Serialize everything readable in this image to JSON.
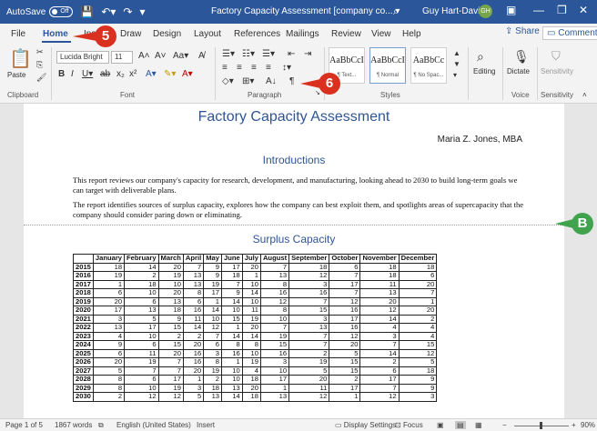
{
  "titlebar": {
    "autosave_label": "AutoSave",
    "autosave_state": "Off",
    "title": "Factory Capacity Assessment [company co...",
    "title_dropdown": "▾",
    "user_name": "Guy Hart-Davis",
    "user_initials": "GH",
    "accent_color": "#2b579a"
  },
  "tabs": {
    "items": [
      "File",
      "Home",
      "Insert",
      "Draw",
      "Design",
      "Layout",
      "References",
      "Mailings",
      "Review",
      "View",
      "Help"
    ],
    "active": "Home",
    "share_label": "Share",
    "comments_label": "Comments"
  },
  "ribbon": {
    "clipboard": {
      "paste_label": "Paste",
      "group_label": "Clipboard"
    },
    "font": {
      "font_name": "Lucida Bright",
      "font_size": "11",
      "group_label": "Font"
    },
    "paragraph": {
      "group_label": "Paragraph"
    },
    "styles": {
      "group_label": "Styles",
      "items": [
        {
          "sample": "AaBbCcI",
          "name": "¶ Text..."
        },
        {
          "sample": "AaBbCcI",
          "name": "¶ Normal"
        },
        {
          "sample": "AaBbCc",
          "name": "¶ No Spac..."
        }
      ]
    },
    "editing_label": "Editing",
    "dictate_label": "Dictate",
    "voice_label": "Voice",
    "sensitivity_label": "Sensitivity",
    "sensitivity_group_label": "Sensitivity"
  },
  "callouts": {
    "step5": "5",
    "step6": "6",
    "stepB": "B"
  },
  "document": {
    "title": "Factory Capacity Assessment",
    "author": "Maria Z. Jones, MBA",
    "h_intro": "Introductions",
    "para1": "This report reviews our company's capacity for research, development, and manufacturing, looking ahead to 2030 to build long-term goals we can target with deliverable plans.",
    "para2": "The report identifies sources of surplus capacity, explores how the company can best exploit them, and spotlights areas of supercapacity that the company should consider paring down or eliminating.",
    "h_surplus": "Surplus Capacity",
    "table": {
      "columns": [
        "",
        "January",
        "February",
        "March",
        "April",
        "May",
        "June",
        "July",
        "August",
        "September",
        "October",
        "November",
        "December"
      ],
      "rows": [
        [
          "2015",
          "18",
          "14",
          "20",
          "7",
          "9",
          "17",
          "20",
          "7",
          "18",
          "6",
          "18",
          "18"
        ],
        [
          "2016",
          "19",
          "2",
          "19",
          "13",
          "9",
          "18",
          "1",
          "13",
          "12",
          "7",
          "18",
          "6"
        ],
        [
          "2017",
          "1",
          "18",
          "10",
          "13",
          "19",
          "7",
          "10",
          "8",
          "3",
          "17",
          "11",
          "20"
        ],
        [
          "2018",
          "6",
          "10",
          "20",
          "8",
          "17",
          "9",
          "14",
          "16",
          "16",
          "7",
          "13",
          "7"
        ],
        [
          "2019",
          "20",
          "6",
          "13",
          "6",
          "1",
          "14",
          "10",
          "12",
          "7",
          "12",
          "20",
          "1"
        ],
        [
          "2020",
          "17",
          "13",
          "18",
          "16",
          "14",
          "10",
          "11",
          "8",
          "15",
          "16",
          "12",
          "20"
        ],
        [
          "2021",
          "3",
          "5",
          "9",
          "11",
          "10",
          "15",
          "19",
          "10",
          "3",
          "17",
          "14",
          "2"
        ],
        [
          "2022",
          "13",
          "17",
          "15",
          "14",
          "12",
          "1",
          "20",
          "7",
          "13",
          "16",
          "4",
          "4"
        ],
        [
          "2023",
          "4",
          "10",
          "2",
          "2",
          "7",
          "14",
          "14",
          "19",
          "7",
          "12",
          "3",
          "4"
        ],
        [
          "2024",
          "9",
          "6",
          "15",
          "20",
          "6",
          "8",
          "8",
          "15",
          "7",
          "20",
          "7",
          "15"
        ],
        [
          "2025",
          "6",
          "11",
          "20",
          "16",
          "3",
          "16",
          "10",
          "16",
          "2",
          "5",
          "14",
          "12"
        ],
        [
          "2026",
          "20",
          "19",
          "7",
          "16",
          "8",
          "1",
          "19",
          "3",
          "19",
          "15",
          "2",
          "5"
        ],
        [
          "2027",
          "5",
          "7",
          "7",
          "20",
          "19",
          "10",
          "4",
          "10",
          "5",
          "15",
          "6",
          "18"
        ],
        [
          "2028",
          "8",
          "6",
          "17",
          "1",
          "2",
          "10",
          "18",
          "17",
          "20",
          "2",
          "17",
          "9"
        ],
        [
          "2029",
          "8",
          "10",
          "19",
          "3",
          "18",
          "13",
          "20",
          "1",
          "11",
          "17",
          "7",
          "9"
        ],
        [
          "2030",
          "2",
          "12",
          "12",
          "5",
          "13",
          "14",
          "18",
          "13",
          "12",
          "1",
          "12",
          "3"
        ]
      ]
    }
  },
  "statusbar": {
    "page": "Page 1 of 5",
    "words": "1867 words",
    "language": "English (United States)",
    "mode": "Insert",
    "display_settings": "Display Settings",
    "focus": "Focus",
    "zoom": "90%"
  }
}
